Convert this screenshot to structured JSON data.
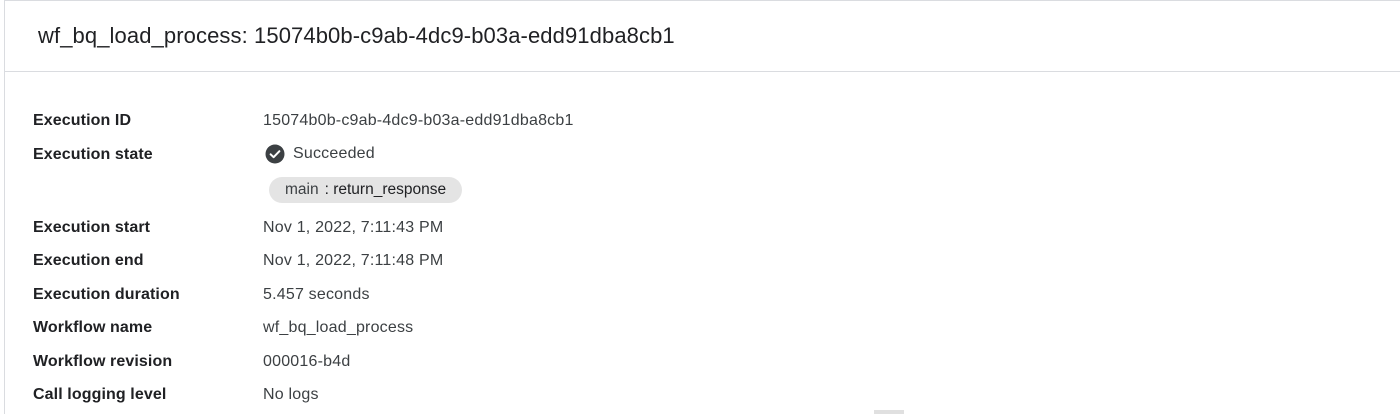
{
  "header": {
    "title": "wf_bq_load_process: 15074b0b-c9ab-4dc9-b03a-edd91dba8cb1"
  },
  "details": {
    "execution_id": {
      "label": "Execution ID",
      "value": "15074b0b-c9ab-4dc9-b03a-edd91dba8cb1"
    },
    "execution_state": {
      "label": "Execution state",
      "value": "Succeeded",
      "icon": "check-circle-icon",
      "status_color": "#3c4043",
      "chip": {
        "main": "main",
        "step": ": return_response"
      }
    },
    "execution_start": {
      "label": "Execution start",
      "value": "Nov 1, 2022, 7:11:43 PM"
    },
    "execution_end": {
      "label": "Execution end",
      "value": "Nov 1, 2022, 7:11:48 PM"
    },
    "execution_duration": {
      "label": "Execution duration",
      "value": "5.457 seconds"
    },
    "workflow_name": {
      "label": "Workflow name",
      "value": "wf_bq_load_process"
    },
    "workflow_revision": {
      "label": "Workflow revision",
      "value": "000016-b4d"
    },
    "call_logging_level": {
      "label": "Call logging level",
      "value": "No logs"
    }
  }
}
